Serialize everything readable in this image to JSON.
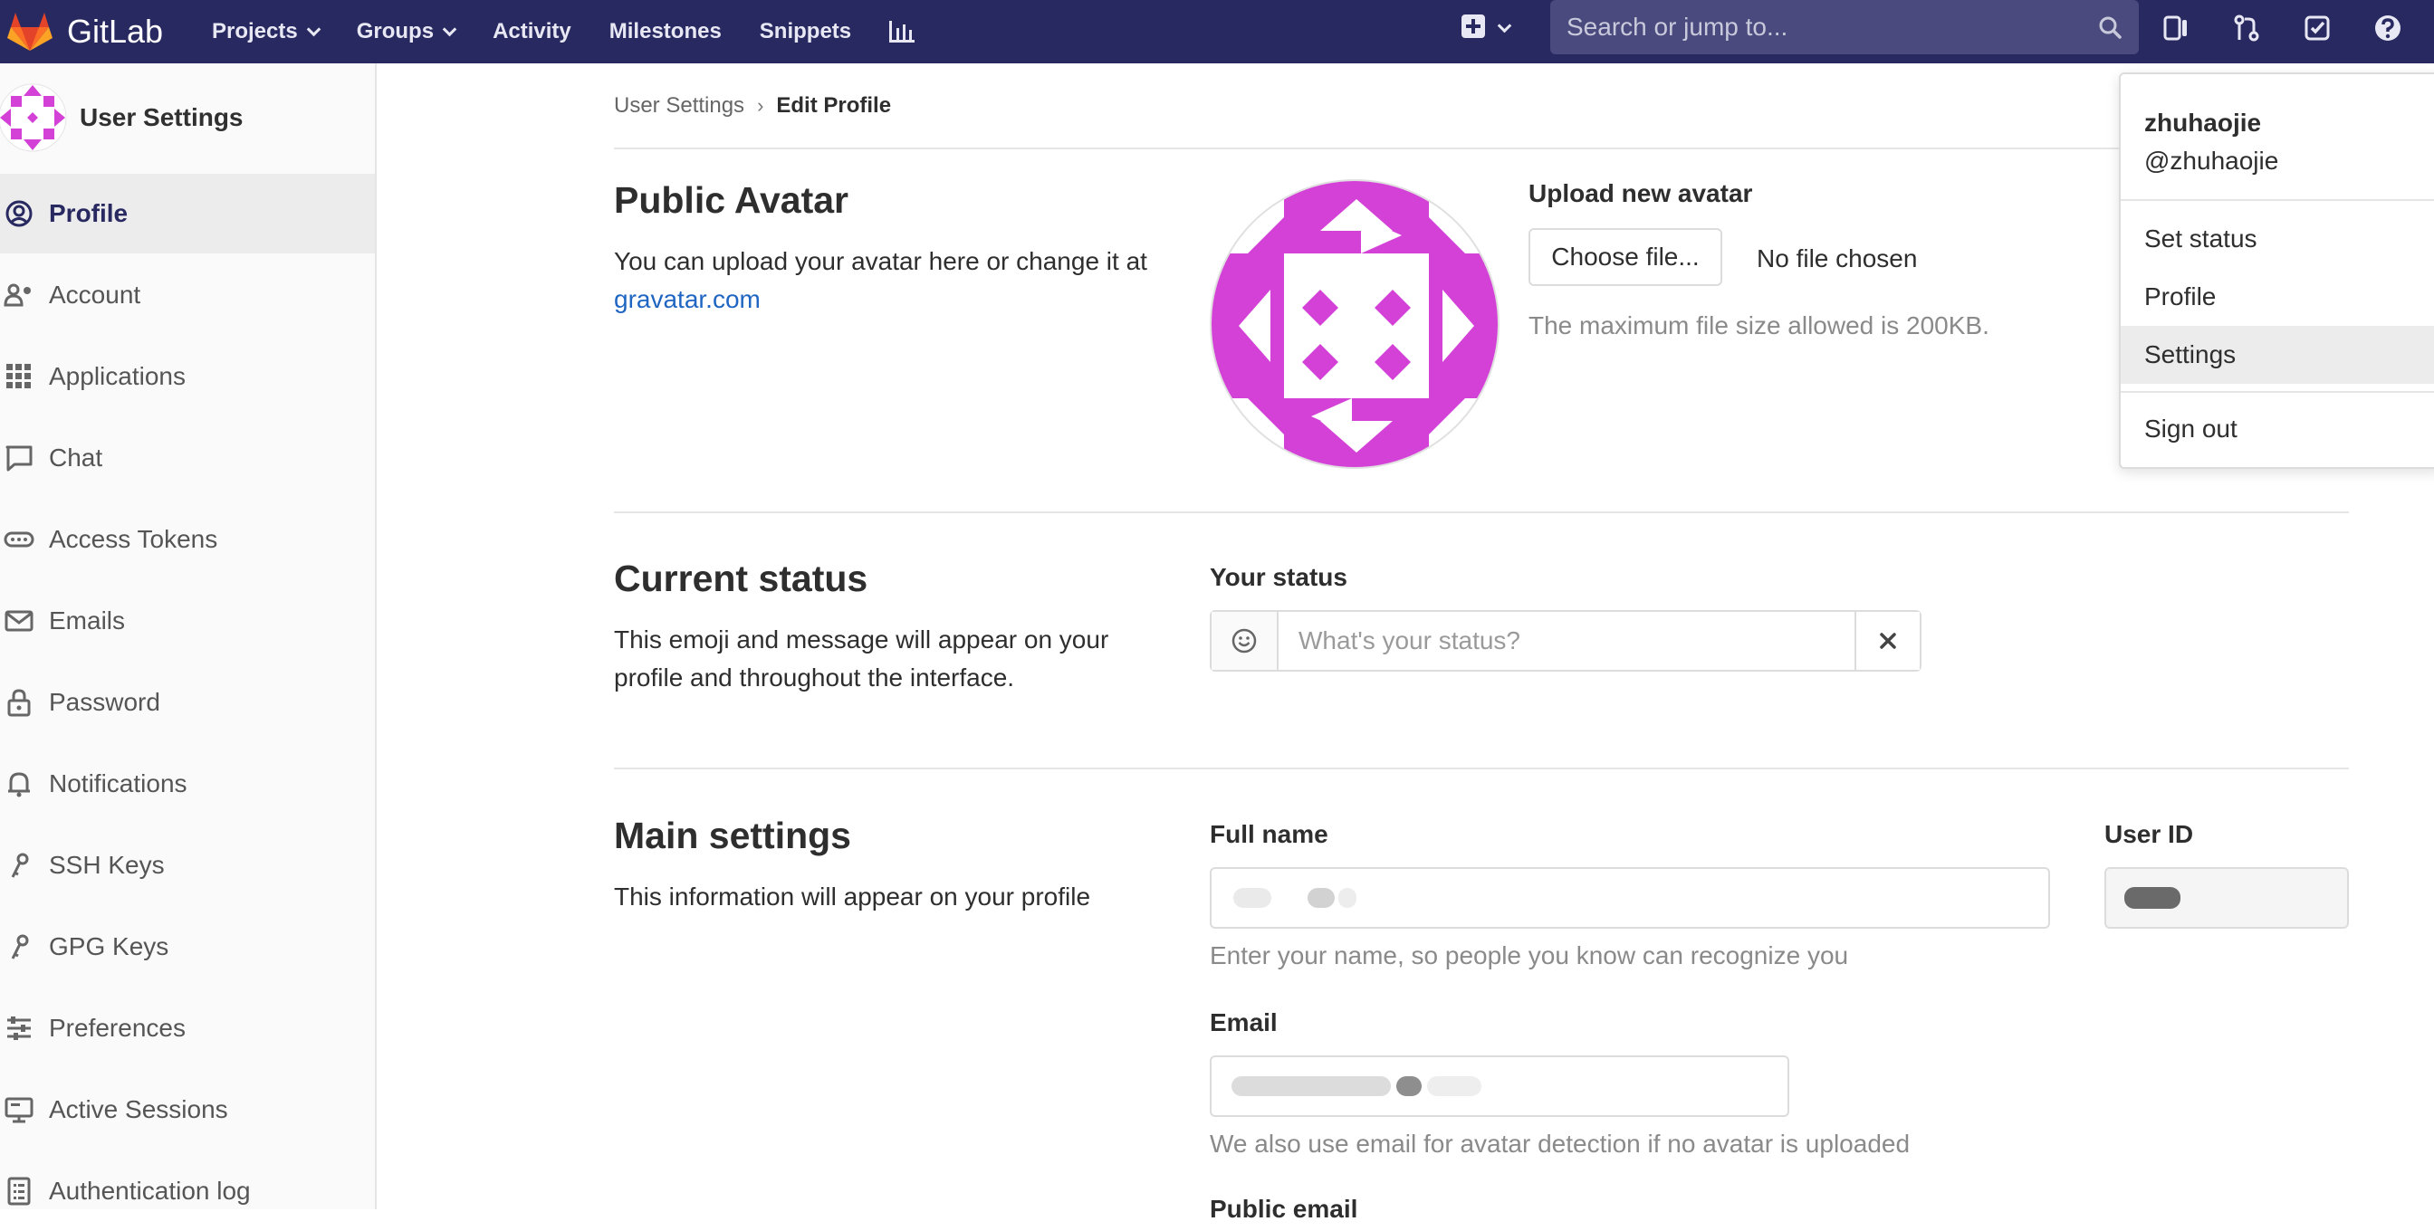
{
  "navbar": {
    "brand": "GitLab",
    "links": [
      "Projects",
      "Groups",
      "Activity",
      "Milestones",
      "Snippets"
    ],
    "search_placeholder": "Search or jump to...",
    "color": "#292961"
  },
  "sidebar": {
    "title": "User Settings",
    "items": [
      {
        "label": "Profile",
        "icon": "profile-icon"
      },
      {
        "label": "Account",
        "icon": "account-icon"
      },
      {
        "label": "Applications",
        "icon": "applications-icon"
      },
      {
        "label": "Chat",
        "icon": "chat-icon"
      },
      {
        "label": "Access Tokens",
        "icon": "token-icon"
      },
      {
        "label": "Emails",
        "icon": "email-icon"
      },
      {
        "label": "Password",
        "icon": "lock-icon"
      },
      {
        "label": "Notifications",
        "icon": "bell-icon"
      },
      {
        "label": "SSH Keys",
        "icon": "key-icon"
      },
      {
        "label": "GPG Keys",
        "icon": "key-icon"
      },
      {
        "label": "Preferences",
        "icon": "sliders-icon"
      },
      {
        "label": "Active Sessions",
        "icon": "monitor-icon"
      },
      {
        "label": "Authentication log",
        "icon": "log-icon"
      }
    ],
    "active_index": 0
  },
  "breadcrumb": {
    "parent": "User Settings",
    "separator": "›",
    "current": "Edit Profile"
  },
  "avatar_section": {
    "title": "Public Avatar",
    "desc_prefix": "You can upload your avatar here or change it at ",
    "desc_link": "gravatar.com",
    "upload_label": "Upload new avatar",
    "choose_button": "Choose file...",
    "file_status": "No file chosen",
    "size_hint": "The maximum file size allowed is 200KB.",
    "avatar_color": "#d441d6"
  },
  "status_section": {
    "title": "Current status",
    "desc": "This emoji and message will appear on your profile and throughout the interface.",
    "label": "Your status",
    "placeholder": "What's your status?"
  },
  "main_section": {
    "title": "Main settings",
    "desc": "This information will appear on your profile",
    "full_name_label": "Full name",
    "full_name_hint": "Enter your name, so people you know can recognize you",
    "user_id_label": "User ID",
    "email_label": "Email",
    "email_hint": "We also use email for avatar detection if no avatar is uploaded",
    "public_email_label": "Public email"
  },
  "user_menu": {
    "name": "zhuhaojie",
    "username": "@zhuhaojie",
    "items": [
      "Set status",
      "Profile",
      "Settings",
      "Sign out"
    ],
    "highlighted": "Settings"
  }
}
